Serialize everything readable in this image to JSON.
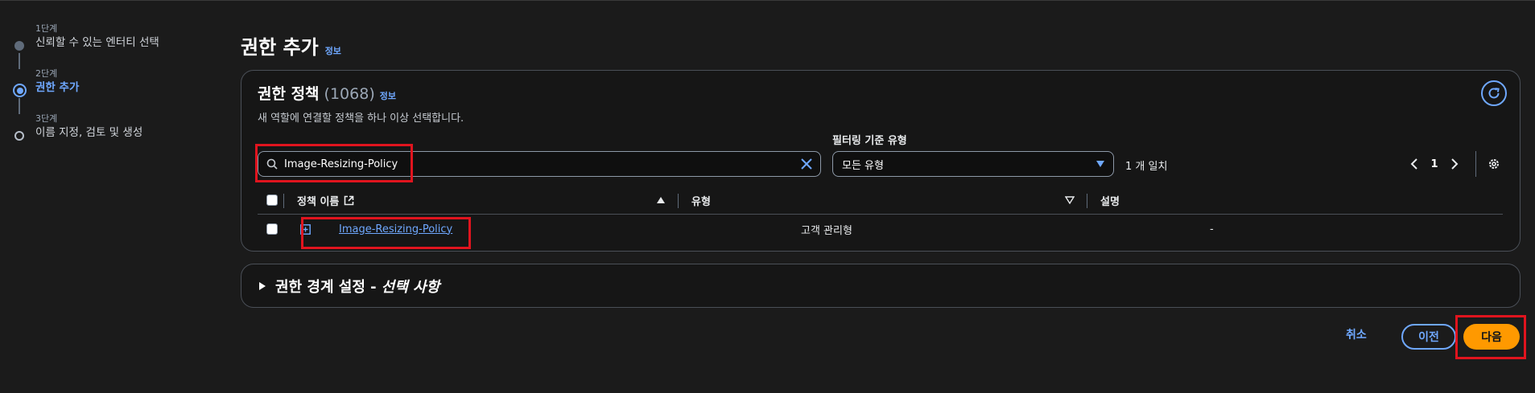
{
  "steps": [
    {
      "num": "1단계",
      "label": "신뢰할 수 있는 엔터티 선택"
    },
    {
      "num": "2단계",
      "label": "권한 추가"
    },
    {
      "num": "3단계",
      "label": "이름 지정, 검토 및 생성"
    }
  ],
  "page": {
    "title": "권한 추가",
    "info": "정보"
  },
  "policies": {
    "title": "권한 정책",
    "count": "(1068)",
    "info": "정보",
    "description": "새 역할에 연결할 정책을 하나 이상 선택합니다.",
    "search_value": "Image-Resizing-Policy",
    "filter_label": "필터링 기준 유형",
    "filter_value": "모든 유형",
    "match_count": "1 개 일치",
    "current_page": "1",
    "columns": {
      "name": "정책 이름",
      "type": "유형",
      "description": "설명"
    },
    "rows": [
      {
        "name": "Image-Resizing-Policy",
        "type": "고객 관리형",
        "description": "-"
      }
    ]
  },
  "boundary": {
    "title": "권한 경계 설정 -",
    "optional": "선택 사항"
  },
  "footer": {
    "cancel": "취소",
    "prev": "이전",
    "next": "다음"
  },
  "colors": {
    "accent": "#6fa8ff",
    "primary_button": "#ff9900",
    "highlight": "#e0141e"
  }
}
